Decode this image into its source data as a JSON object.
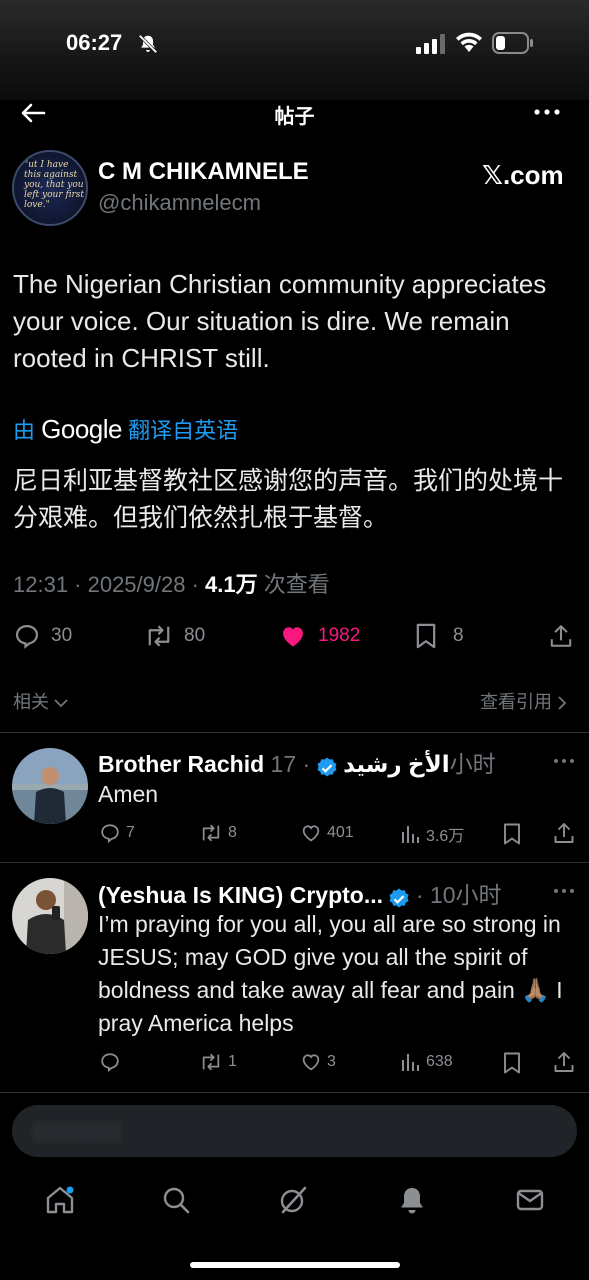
{
  "status_bar": {
    "time": "06:27"
  },
  "nav": {
    "title": "帖子"
  },
  "post": {
    "author_name": "C M CHIKAMNELE",
    "author_handle": "@chikamnelecm",
    "watermark": "𝕏.com",
    "avatar_text": "\"ut I have this against you, that you left your first love.\"",
    "text": "The Nigerian Christian community appreciates your voice.  Our situation is dire. We remain rooted in CHRIST still.",
    "translate_prefix": "由",
    "translate_brand": "Google",
    "translate_suffix": "翻译自英语",
    "translated_text": "尼日利亚基督教社区感谢您的声音。我们的处境十分艰难。但我们依然扎根于基督。",
    "time": "12:31 · 2025/9/28 · ",
    "views_value": "4.1万",
    "views_label": " 次查看",
    "replies": "30",
    "reposts": "80",
    "likes": "1982",
    "bookmarks": "8",
    "like_color": "#f91880",
    "accent": "#1d9bf0"
  },
  "related_label": "相关",
  "quotes_label": "查看引用",
  "replies": [
    {
      "name": "Brother Rachid الأخ رشيد",
      "time": "· 17小时",
      "text": "Amen",
      "replies": "7",
      "reposts": "8",
      "likes": "401",
      "views": "3.6万"
    },
    {
      "name": "(Yeshua Is KING) Crypto...",
      "time": "· 10小时",
      "text": "I’m praying for you all, you all are so strong in JESUS; may GOD give you all the spirit of boldness and take away all fear and pain 🙏🏽 I pray America helps",
      "replies": "",
      "reposts": "1",
      "likes": "3",
      "views": "638"
    }
  ],
  "tabbar": {
    "icons": [
      "home-icon",
      "search-icon",
      "grok-icon",
      "notifications-icon",
      "messages-icon"
    ]
  }
}
